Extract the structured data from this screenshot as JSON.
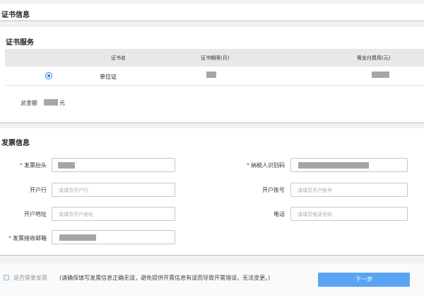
{
  "cert_info": {
    "title": "证书信息"
  },
  "cert_service": {
    "title": "证书服务",
    "columns": [
      "证书名",
      "证书期限(月)",
      "需支付费用(元)"
    ],
    "rows": [
      {
        "name": "单位证",
        "selected": true
      }
    ],
    "total_label": "总金额",
    "total_unit": "元"
  },
  "invoice": {
    "title": "发票信息",
    "fields": {
      "header": {
        "label": "发票抬头",
        "required": true
      },
      "tax_id": {
        "label": "纳税人识别码",
        "required": true
      },
      "bank": {
        "label": "开户行",
        "placeholder": "请填写开户行"
      },
      "account": {
        "label": "开户账号",
        "placeholder": "请填写开户账号"
      },
      "address": {
        "label": "开户地址",
        "placeholder": "请填写开户地址"
      },
      "phone": {
        "label": "电话",
        "placeholder": "请填写电话号码"
      },
      "email": {
        "label": "发票接收邮箱",
        "required": true
      }
    }
  },
  "footer": {
    "need_invoice_label": "是否需要发票",
    "note": "(请确保填写发票信息正确无误，避免提供开票信息有误而导致开票错误，无法变更。)",
    "next_label": "下一步"
  },
  "colors": {
    "accent": "#1f7ce8",
    "button": "#5aa4f4",
    "required": "#e03a3a"
  }
}
